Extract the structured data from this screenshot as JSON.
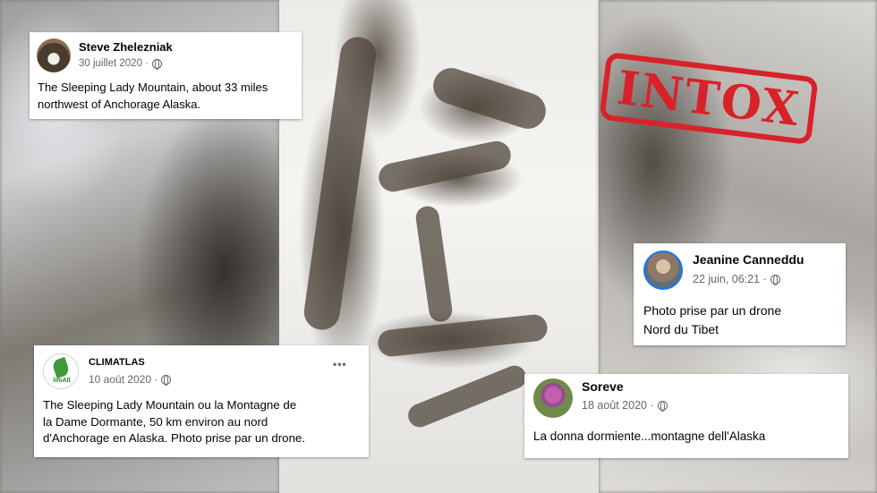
{
  "stamp": {
    "label": "INTOX",
    "color": "#d8222a"
  },
  "posts": [
    {
      "author": "Steve Zhelezniak",
      "date": "30 juillet 2020 ·",
      "text_lines": [
        "The Sleeping Lady Mountain, about 33 miles",
        "northwest of Anchorage Alaska."
      ],
      "avatar_icon": "dog-photo-avatar"
    },
    {
      "author": "CLIMATLAS",
      "date": "10 août 2020 ·",
      "text_lines": [
        "The Sleeping Lady Mountain ou la Montagne de",
        "la Dame Dormante, 50 km environ au nord",
        "d'Anchorage en Alaska. Photo prise par un drone."
      ],
      "avatar_icon": "climatlas-logo-avatar",
      "avatar_text": "limAtl",
      "more_label": "•••"
    },
    {
      "author": "Jeanine Canneddu",
      "date": "22 juin, 06:21 ·",
      "text_lines": [
        "Photo prise par un drone",
        "Nord du Tibet"
      ],
      "avatar_icon": "person-photo-avatar"
    },
    {
      "author": "Soreve",
      "date": "18 août 2020 ·",
      "text_lines": [
        "La donna dormiente...montagne dell'Alaska"
      ],
      "avatar_icon": "flower-photo-avatar"
    }
  ]
}
